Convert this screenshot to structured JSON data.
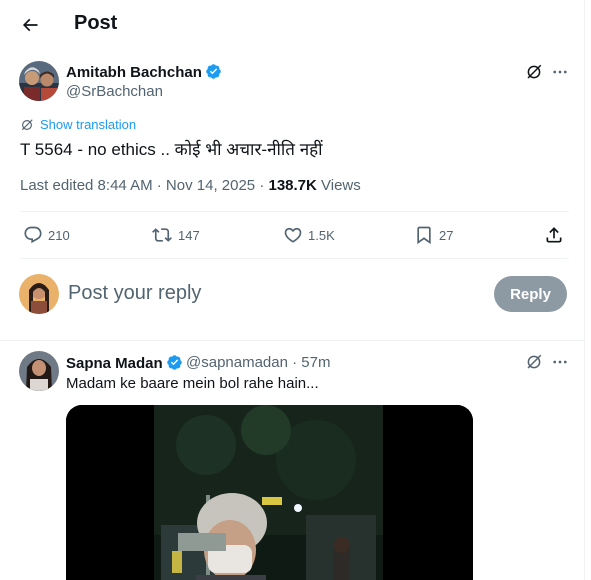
{
  "header": {
    "title": "Post"
  },
  "post": {
    "author": {
      "name": "Amitabh Bachchan",
      "handle": "@SrBachchan"
    },
    "translate_label": "Show translation",
    "text": "T 5564 - no ethics .. कोई भी अचार-नीति नहीं",
    "edited_prefix": "Last edited 8:44 AM · Nov 14, 2025 · ",
    "views_count": "138.7K",
    "views_label": " Views",
    "stats": {
      "replies": "210",
      "reposts": "147",
      "likes": "1.5K",
      "bookmarks": "27"
    }
  },
  "reply_box": {
    "placeholder": "Post your reply",
    "button_label": "Reply"
  },
  "reply": {
    "name": "Sapna Madan",
    "handle_time": "@sapnamadan · 57m",
    "text": "Madam ke baare mein bol rahe hain..."
  },
  "colors": {
    "accent": "#1d9bf0",
    "secondary_text": "#536471",
    "divider": "#eff3f4",
    "reply_button_disabled": "#8e9aa3"
  }
}
